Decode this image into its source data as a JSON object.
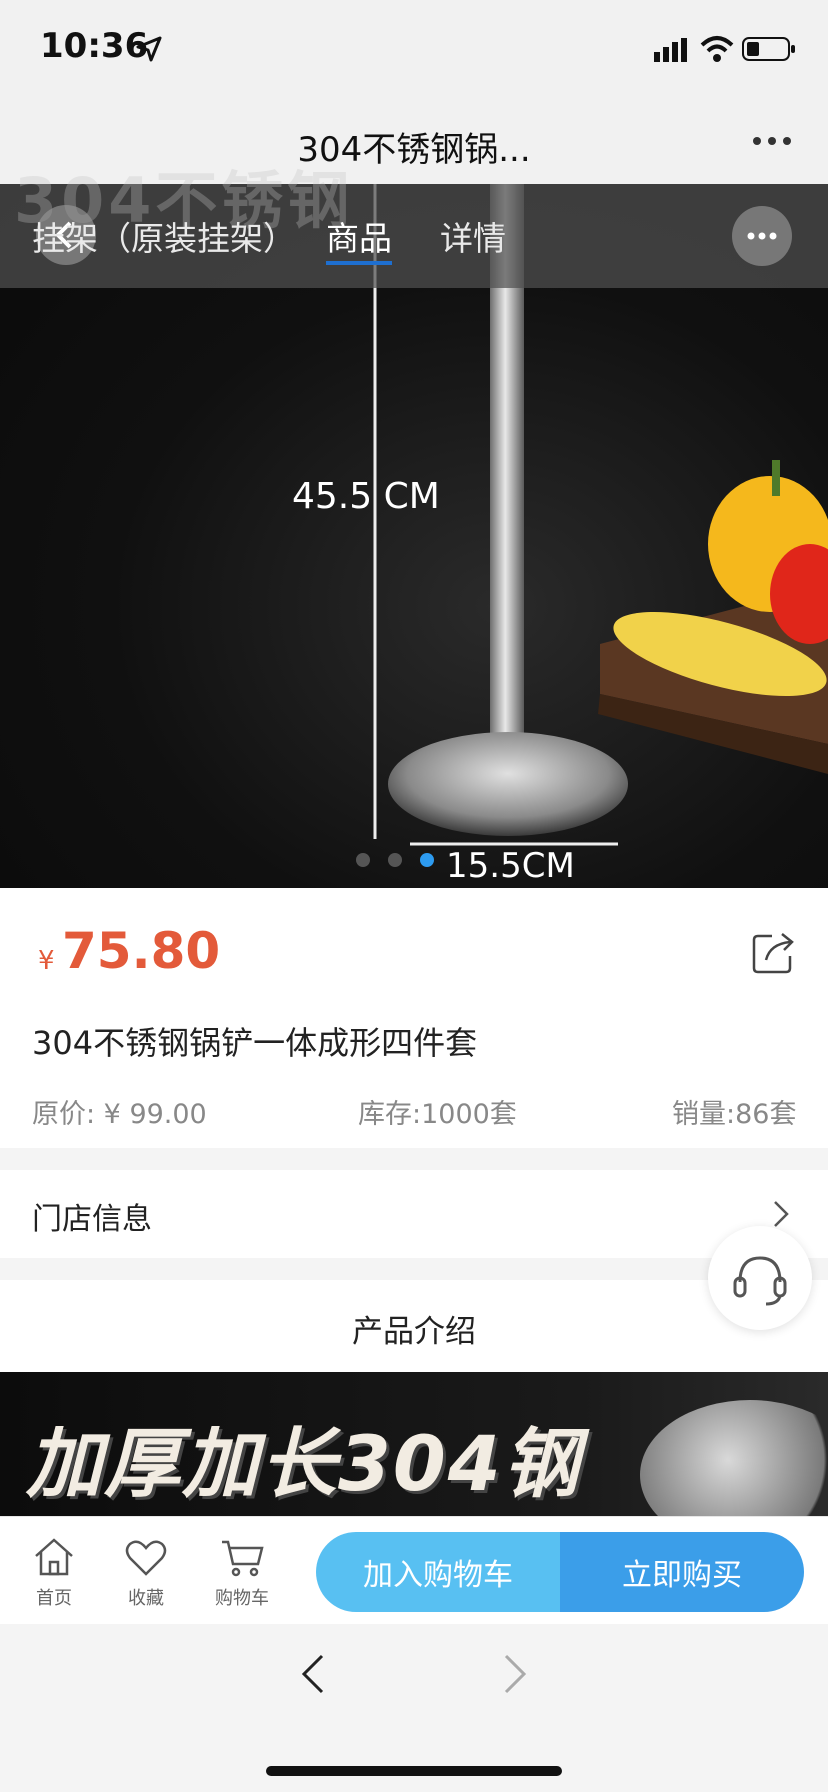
{
  "status_bar": {
    "time": "10:36"
  },
  "title_bar": {
    "title": "304不锈钢锅..."
  },
  "hero": {
    "top_text": "304不锈钢",
    "tabs": [
      {
        "label": "挂架（原装挂架）"
      },
      {
        "label": "商品"
      },
      {
        "label": "详情"
      }
    ],
    "dim_height": "45.5 CM",
    "dim_base": "15.5CM",
    "carousel": {
      "count": 3,
      "active_index": 3
    }
  },
  "product": {
    "currency": "¥",
    "price": "75.80",
    "name": "304不锈钢锅铲一体成形四件套",
    "original_price": "原价: ¥ 99.00",
    "stock": "库存:1000套",
    "sales": "销量:86套"
  },
  "store_info": {
    "label": "门店信息"
  },
  "intro": {
    "label": "产品介绍"
  },
  "banner": {
    "text": "加厚加长304钢"
  },
  "bottom_bar": {
    "home": "首页",
    "favorite": "收藏",
    "cart": "购物车",
    "add_to_cart": "加入购物车",
    "buy_now": "立即购买"
  },
  "colors": {
    "price": "#e35a3a",
    "cart_button": "#58c0f2",
    "buy_button": "#3b9ee9",
    "active_dot": "#2d9bf0"
  }
}
